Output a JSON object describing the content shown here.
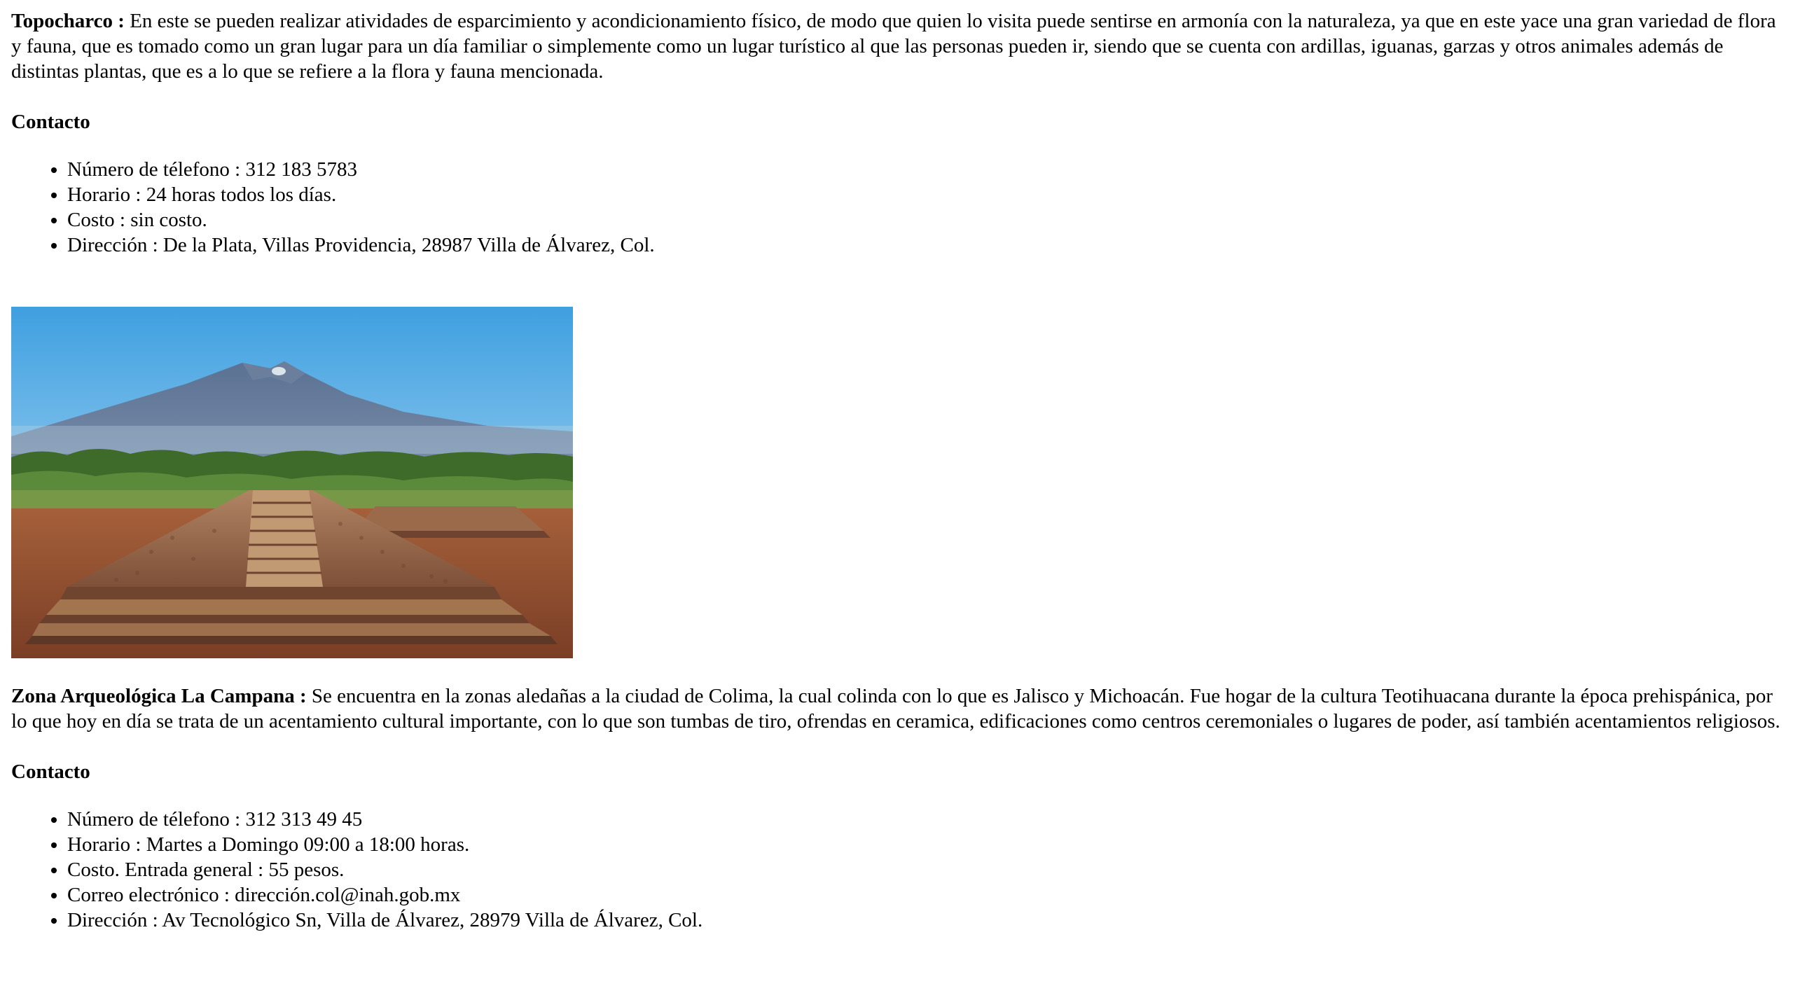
{
  "sections": [
    {
      "name": "Topocharco :",
      "description": "En este se pueden realizar atividades de esparcimiento y acondicionamiento físico, de modo que quien lo visita puede sentirse en armonía con la naturaleza, ya que en este yace una gran variedad de flora y fauna, que es tomado como un gran lugar para un día familiar o simplemente como un lugar turístico al que las personas pueden ir, siendo que se cuenta con ardillas, iguanas, garzas y otros animales además de distintas plantas, que es a lo que se refiere a la flora y fauna mencionada.",
      "contact_heading": "Contacto",
      "contact_items": [
        "Número de télefono : 312 183 5783",
        "Horario : 24 horas todos los días.",
        "Costo : sin costo.",
        "Dirección : De la Plata, Villas Providencia, 28987 Villa de Álvarez, Col."
      ]
    },
    {
      "name": "Zona Arqueológica La Campana :",
      "description": "Se encuentra en la zonas aledañas a la ciudad de Colima, la cual colinda con lo que es Jalisco y Michoacán. Fue hogar de la cultura Teotihuacana durante la época prehispánica, por lo que hoy en día se trata de un acentamiento cultural importante, con lo que son tumbas de tiro, ofrendas en ceramica, edificaciones como centros ceremoniales o lugares de poder, así también acentamientos religiosos.",
      "contact_heading": "Contacto",
      "contact_items": [
        "Número de télefono : 312 313 49 45",
        "Horario : Martes a Domingo 09:00 a 18:00 horas.",
        "Costo. Entrada general : 55 pesos.",
        "Correo electrónico : dirección.col@inah.gob.mx",
        "Dirección : Av Tecnológico Sn, Villa de Álvarez, 28979 Villa de Álvarez, Col."
      ]
    }
  ],
  "photo": {
    "subject": "archaeological-site-with-volcano",
    "colors": {
      "sky_top": "#3f9fe0",
      "sky_bottom": "#cfe8f6",
      "mountain": "#4f6684",
      "vegetation": "#3f6b2a",
      "pyramid": "#9b6b4a",
      "ground": "#8b4a2e"
    }
  }
}
